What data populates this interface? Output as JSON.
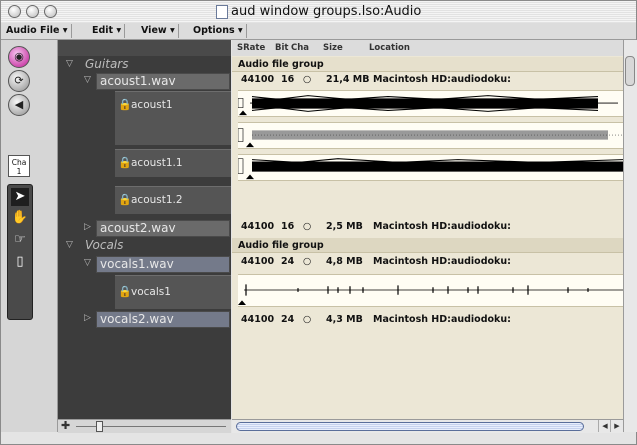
{
  "window": {
    "title": "aud window groups.lso:Audio"
  },
  "menus": [
    "Audio File ▾",
    "Edit ▾",
    "View ▾",
    "Options ▾"
  ],
  "toolstrip": {
    "cha_label": "Cha",
    "cha_value": "1"
  },
  "columns": {
    "srate": "SRate",
    "bit": "Bit",
    "cha": "Cha",
    "size": "Size",
    "location": "Location"
  },
  "tree": {
    "group1": "Guitars",
    "file1": "acoust1.wav",
    "regions1": [
      "acoust1",
      "acoust1.1",
      "acoust1.2"
    ],
    "file2": "acoust2.wav",
    "group2": "Vocals",
    "file3": "vocals1.wav",
    "regions3": [
      "vocals1"
    ],
    "file4": "vocals2.wav"
  },
  "rows": {
    "group_label": "Audio file group",
    "acoust1": {
      "srate": "44100",
      "bit": "16",
      "cha": "○",
      "size": "21,4 MB",
      "location": "Macintosh HD:audiodoku:"
    },
    "acoust2": {
      "srate": "44100",
      "bit": "16",
      "cha": "○",
      "size": "2,5 MB",
      "location": "Macintosh HD:audiodoku:"
    },
    "vocals1": {
      "srate": "44100",
      "bit": "24",
      "cha": "○",
      "size": "4,8 MB",
      "location": "Macintosh HD:audiodoku:"
    },
    "vocals2": {
      "srate": "44100",
      "bit": "24",
      "cha": "○",
      "size": "4,3 MB",
      "location": "Macintosh HD:audiodoku:"
    }
  },
  "icons": {
    "record": "record-icon",
    "loop": "loop-icon",
    "speaker": "speaker-icon",
    "pointer": "pointer-icon",
    "hand": "hand-icon",
    "finger": "finger-icon",
    "eraser": "eraser-icon",
    "lock": "lock-icon",
    "zoom": "zoom-icon"
  },
  "colors": {
    "accent": "#cc44aa",
    "tree_bg": "#3c3c3c",
    "list_bg": "#ece7d6"
  }
}
